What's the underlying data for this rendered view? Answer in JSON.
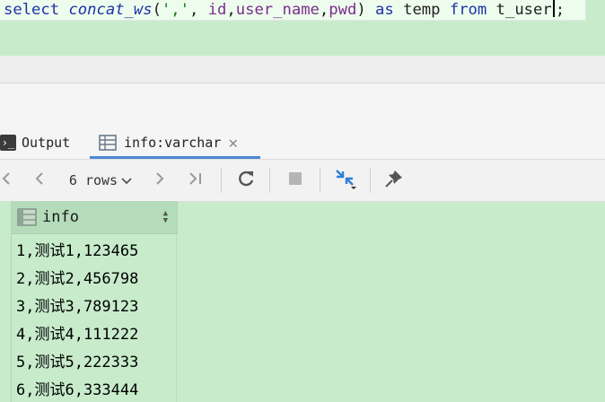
{
  "editor": {
    "tokens": {
      "select": "select",
      "concat_ws": "concat_ws",
      "open": "(",
      "sep_str": "','",
      "args": ", ",
      "id": "id",
      "comma1": ",",
      "user_name": "user_name",
      "comma2": ",",
      "pwd": "pwd",
      "close": ")",
      "as": "as",
      "temp": "temp",
      "from": "from",
      "table": "t_user",
      "semi": ";"
    }
  },
  "tabs": {
    "output_label": "Output",
    "info_label": "info:varchar"
  },
  "toolbar": {
    "rows_label": "6 rows"
  },
  "grid": {
    "header": "info",
    "rows": [
      "1,测试1,123465",
      "2,测试2,456798",
      "3,测试3,789123",
      "4,测试4,111222",
      "5,测试5,222333",
      "6,测试6,333444"
    ]
  },
  "colors": {
    "background": "#c7ebcb",
    "header_bg": "#b4dcba",
    "accent": "#4c87d6",
    "keyword": "#1d32a8"
  },
  "icons": [
    "terminal-icon",
    "table-grid-icon",
    "close-icon",
    "first-page-icon",
    "prev-page-icon",
    "chevron-down-icon",
    "next-page-icon",
    "last-page-icon",
    "refresh-icon",
    "stop-icon",
    "compare-icon",
    "pin-icon",
    "column-grid-icon",
    "sort-icon"
  ]
}
